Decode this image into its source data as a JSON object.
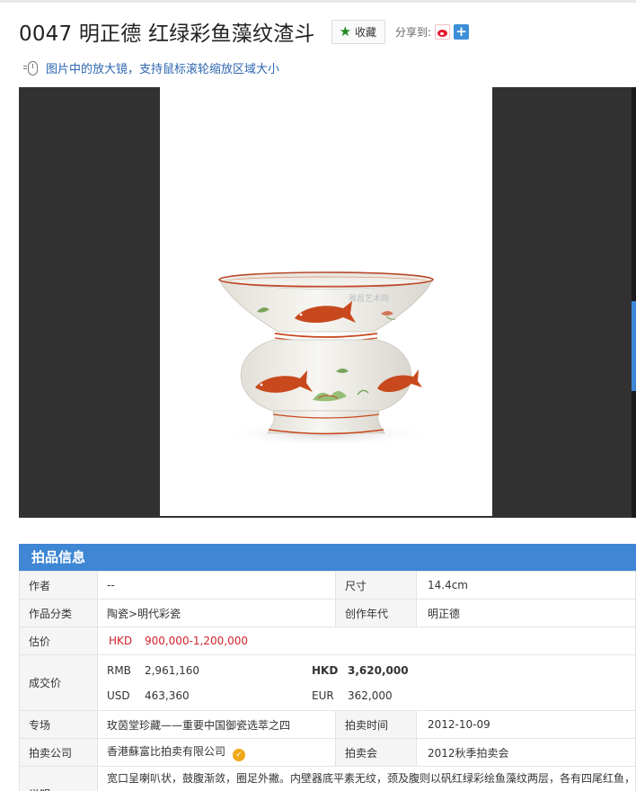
{
  "lot": {
    "title": "0047 明正德 红绿彩鱼藻纹渣斗",
    "favorite_label": "收藏",
    "share_label": "分享到:",
    "share_icons": [
      "weibo-icon",
      "plus-icon"
    ]
  },
  "zoom_tip": "图片中的放大镜，支持鼠标滚轮缩放区域大小",
  "photo": {
    "watermark": "雅昌艺术网",
    "subject": "zhadou",
    "glaze_color": "#f3f1ec",
    "iron_red": "#c8491d"
  },
  "info": {
    "section_title": "拍品信息",
    "author_label": "作者",
    "author_value": "--",
    "size_label": "尺寸",
    "size_value": "14.4cm",
    "category_label": "作品分类",
    "category_value": "陶瓷>明代彩瓷",
    "era_label": "创作年代",
    "era_value": "明正德",
    "estimate_label": "估价",
    "estimate_currency": "HKD",
    "estimate_value": "900,000-1,200,000",
    "price_label": "成交价",
    "prices": {
      "rmb_label": "RMB",
      "rmb_value": "2,961,160",
      "hkd_label": "HKD",
      "hkd_value": "3,620,000",
      "usd_label": "USD",
      "usd_value": "463,360",
      "eur_label": "EUR",
      "eur_value": "362,000"
    },
    "session_label": "专场",
    "session_value": "玫茵堂珍藏——重要中国御瓷选萃之四",
    "auction_time_label": "拍卖时间",
    "auction_time_value": "2012-10-09",
    "company_label": "拍卖公司",
    "company_value": "香港蘇富比拍卖有限公司",
    "event_label": "拍卖会",
    "event_value": "2012秋季拍卖会",
    "desc_label": "说明",
    "desc_value": "宽口呈喇叭状，鼓腹渐敛，圈足外撇。内壁器底平素无纹，颈及腹则以矾红绿彩绘鱼藻纹两层，各有四尾红鱼，"
  },
  "colors": {
    "header_blue": "#3f86d5",
    "link_blue": "#2e67b1",
    "price_red": "#d0232a",
    "viewer_bg": "#313131",
    "star_green": "#1f8a1f"
  }
}
